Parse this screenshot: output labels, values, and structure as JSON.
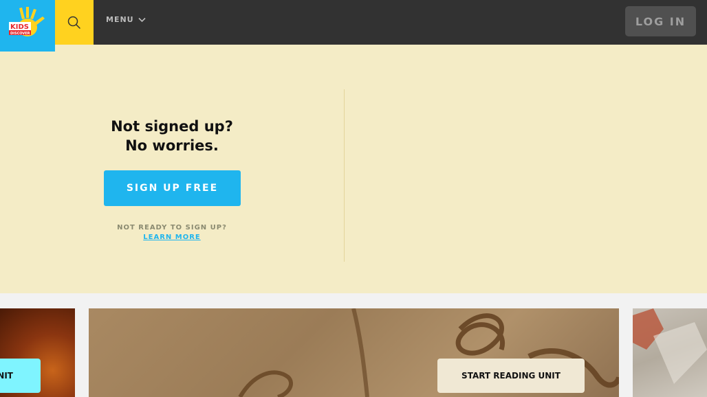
{
  "header": {
    "logo_line1": "KIDS",
    "logo_line2": "DISCOVER",
    "menu_label": "MENU",
    "login_label": "LOG IN"
  },
  "hero": {
    "title_line1": "Not signed up?",
    "title_line2": "No worries.",
    "signup_label": "SIGN UP FREE",
    "not_ready": "NOT READY TO SIGN UP?",
    "learn_more": "LEARN MORE"
  },
  "cards": {
    "left_button": "NIT",
    "mid_button": "START READING UNIT"
  },
  "colors": {
    "brand_blue": "#1fb5ee",
    "brand_yellow": "#ffd21f",
    "header_bg": "#323232",
    "hero_bg": "#f4ecc6"
  }
}
